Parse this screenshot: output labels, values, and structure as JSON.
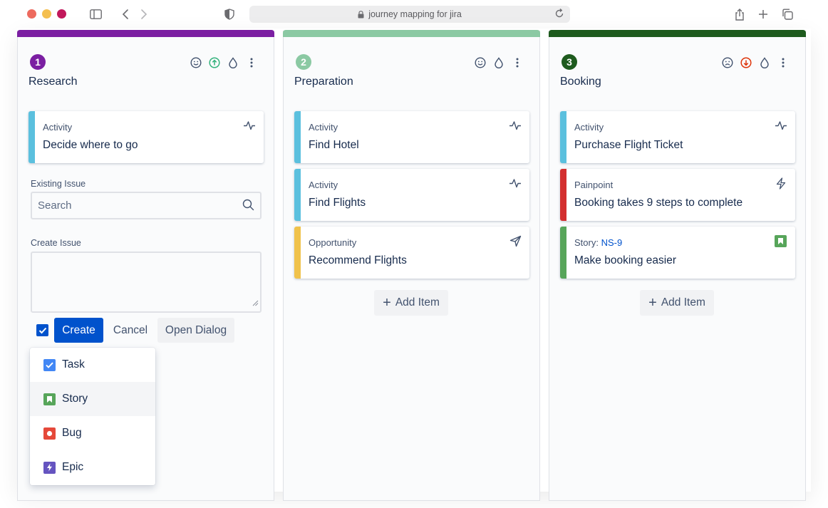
{
  "browser": {
    "url": "journey mapping for jira"
  },
  "colors": {
    "traffic_red": "#ed6a5e",
    "traffic_yellow": "#f4bf4f",
    "traffic_green": "#c2185b",
    "col1": "#7b1fa2",
    "col2": "#8bc9a3",
    "col3": "#1e5b1e",
    "activity": "#5bc0de",
    "opportunity": "#f0c24b",
    "painpoint": "#d32f2f",
    "story": "#57a55a",
    "primary": "#0052cc",
    "bug": "#e5493a",
    "epic": "#6554c0",
    "task": "#4287f5"
  },
  "columns": [
    {
      "number": "1",
      "title": "Research",
      "icons": [
        "smile-icon",
        "arrow-up-circle-icon",
        "drop-icon",
        "more-vertical-icon"
      ],
      "cards": [
        {
          "type": "Activity",
          "title": "Decide where to go",
          "icon": "pulse-icon"
        }
      ],
      "existing_label": "Existing Issue",
      "search_placeholder": "Search",
      "create_label": "Create Issue",
      "create_button": "Create",
      "cancel_button": "Cancel",
      "dialog_button": "Open Dialog",
      "issue_types": [
        {
          "label": "Task",
          "icon": "task-icon"
        },
        {
          "label": "Story",
          "icon": "story-icon"
        },
        {
          "label": "Bug",
          "icon": "bug-icon"
        },
        {
          "label": "Epic",
          "icon": "epic-icon"
        }
      ]
    },
    {
      "number": "2",
      "title": "Preparation",
      "icons": [
        "smile-icon",
        "drop-icon",
        "more-vertical-icon"
      ],
      "cards": [
        {
          "type": "Activity",
          "title": "Find Hotel",
          "icon": "pulse-icon"
        },
        {
          "type": "Activity",
          "title": "Find Flights",
          "icon": "pulse-icon"
        },
        {
          "type": "Opportunity",
          "title": "Recommend Flights",
          "icon": "send-icon"
        }
      ],
      "add_item": "Add Item"
    },
    {
      "number": "3",
      "title": "Booking",
      "icons": [
        "frown-icon",
        "arrow-down-circle-icon",
        "drop-icon",
        "more-vertical-icon"
      ],
      "cards": [
        {
          "type": "Activity",
          "title": "Purchase Flight Ticket",
          "icon": "pulse-icon"
        },
        {
          "type": "Painpoint",
          "title": "Booking takes 9 steps to complete",
          "icon": "lightning-icon"
        },
        {
          "type": "Story:",
          "key": "NS-9",
          "title": "Make booking easier",
          "icon": "story-icon"
        }
      ],
      "add_item": "Add Item"
    }
  ]
}
